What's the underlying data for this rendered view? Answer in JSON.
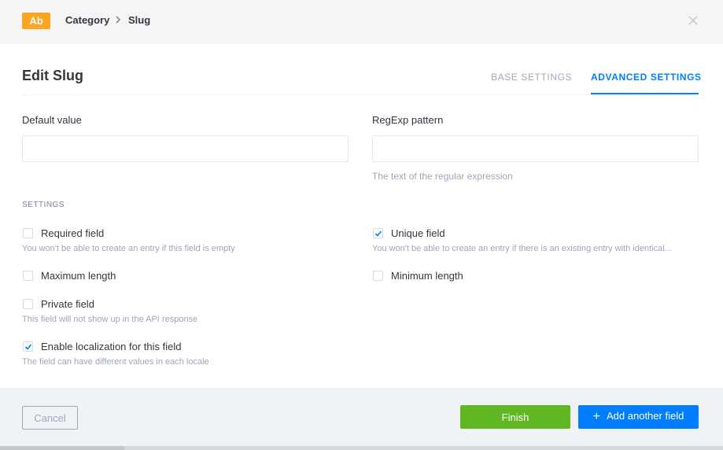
{
  "header": {
    "type_badge": "Ab",
    "breadcrumb": [
      "Category",
      "Slug"
    ]
  },
  "modal": {
    "title": "Edit Slug",
    "tabs": [
      {
        "label": "BASE SETTINGS",
        "active": false
      },
      {
        "label": "ADVANCED SETTINGS",
        "active": true
      }
    ]
  },
  "form": {
    "default_value": {
      "label": "Default value",
      "value": ""
    },
    "regexp": {
      "label": "RegExp pattern",
      "value": "",
      "hint": "The text of the regular expression"
    }
  },
  "settings": {
    "section_title": "SETTINGS",
    "required": {
      "label": "Required field",
      "checked": false,
      "hint": "You won't be able to create an entry if this field is empty"
    },
    "unique": {
      "label": "Unique field",
      "checked": true,
      "hint": "You won't be able to create an entry if there is an existing entry with identical..."
    },
    "max_length": {
      "label": "Maximum length",
      "checked": false
    },
    "min_length": {
      "label": "Minimum length",
      "checked": false
    },
    "private": {
      "label": "Private field",
      "checked": false,
      "hint": "This field will not show up in the API response"
    },
    "localization": {
      "label": "Enable localization for this field",
      "checked": true,
      "hint": "The field can have different values in each locale"
    }
  },
  "footer": {
    "cancel_label": "Cancel",
    "finish_label": "Finish",
    "add_label": "Add another field",
    "add_icon": "+"
  },
  "colors": {
    "accent": "#007eff",
    "finish": "#5fb722",
    "badge": "#faa623"
  }
}
